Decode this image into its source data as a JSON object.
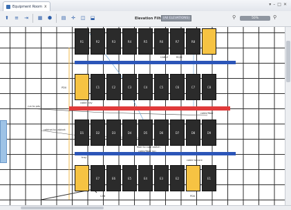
{
  "window": {
    "tab_title": "Equipment Room",
    "tab_close": "x"
  },
  "window_controls": [
    "▾",
    "–",
    "□",
    "✕"
  ],
  "toolbar": {
    "buttons": [
      "⬆",
      "≡",
      "⇥",
      "▦",
      "⬢",
      "▤",
      "✛",
      "◫",
      "⬓"
    ],
    "elevation_label": "Elevation Filter:",
    "elevation_value": "(All ELEVATIONS)",
    "zoom_value": "50%"
  },
  "rows": [
    {
      "racks": [
        {
          "label": "R1",
          "color": "dark"
        },
        {
          "label": "R2",
          "color": "dark"
        },
        {
          "label": "R3",
          "color": "dark"
        },
        {
          "label": "R4",
          "color": "dark"
        },
        {
          "label": "R5",
          "color": "dark"
        },
        {
          "label": "R6",
          "color": "dark"
        },
        {
          "label": "R7",
          "color": "dark"
        },
        {
          "label": "R8",
          "color": "dark"
        },
        {
          "label": "",
          "color": "yellow"
        }
      ]
    },
    {
      "racks": [
        {
          "label": "",
          "color": "yellow"
        },
        {
          "label": "C1",
          "color": "dark"
        },
        {
          "label": "C2",
          "color": "dark"
        },
        {
          "label": "C3",
          "color": "dark"
        },
        {
          "label": "C4",
          "color": "dark"
        },
        {
          "label": "C5",
          "color": "dark"
        },
        {
          "label": "C6",
          "color": "dark"
        },
        {
          "label": "C7",
          "color": "dark"
        },
        {
          "label": "C8",
          "color": "dark"
        }
      ]
    },
    {
      "racks": [
        {
          "label": "D1",
          "color": "dark"
        },
        {
          "label": "D2",
          "color": "dark"
        },
        {
          "label": "D3",
          "color": "dark"
        },
        {
          "label": "D4",
          "color": "dark"
        },
        {
          "label": "D5",
          "color": "dark"
        },
        {
          "label": "D6",
          "color": "dark"
        },
        {
          "label": "D7",
          "color": "dark"
        },
        {
          "label": "D8",
          "color": "dark"
        },
        {
          "label": "D9",
          "color": "dark"
        }
      ]
    },
    {
      "racks": [
        {
          "label": "",
          "color": "yellow"
        },
        {
          "label": "E7",
          "color": "dark"
        },
        {
          "label": "E6",
          "color": "dark"
        },
        {
          "label": "E5",
          "color": "dark"
        },
        {
          "label": "E4",
          "color": "dark"
        },
        {
          "label": "E3",
          "color": "dark"
        },
        {
          "label": "E2",
          "color": "dark"
        },
        {
          "label": "",
          "color": "yellow"
        },
        {
          "label": "E1",
          "color": "dark"
        }
      ]
    }
  ],
  "notes": [
    "CABLE",
    "R0/H",
    "PDU",
    "cable tray",
    "run to pdu",
    "cable/fiber",
    "cabinet to cabinet",
    "tray",
    "fiber to core switch",
    "cable/fiber run",
    "cable to core",
    "CAB",
    "PDU"
  ],
  "colors": {
    "blue_bar": "#2b55b8",
    "red_bar": "#e03a3a",
    "rack": "#2b2b2b",
    "rack_highlight": "#f6c343"
  }
}
